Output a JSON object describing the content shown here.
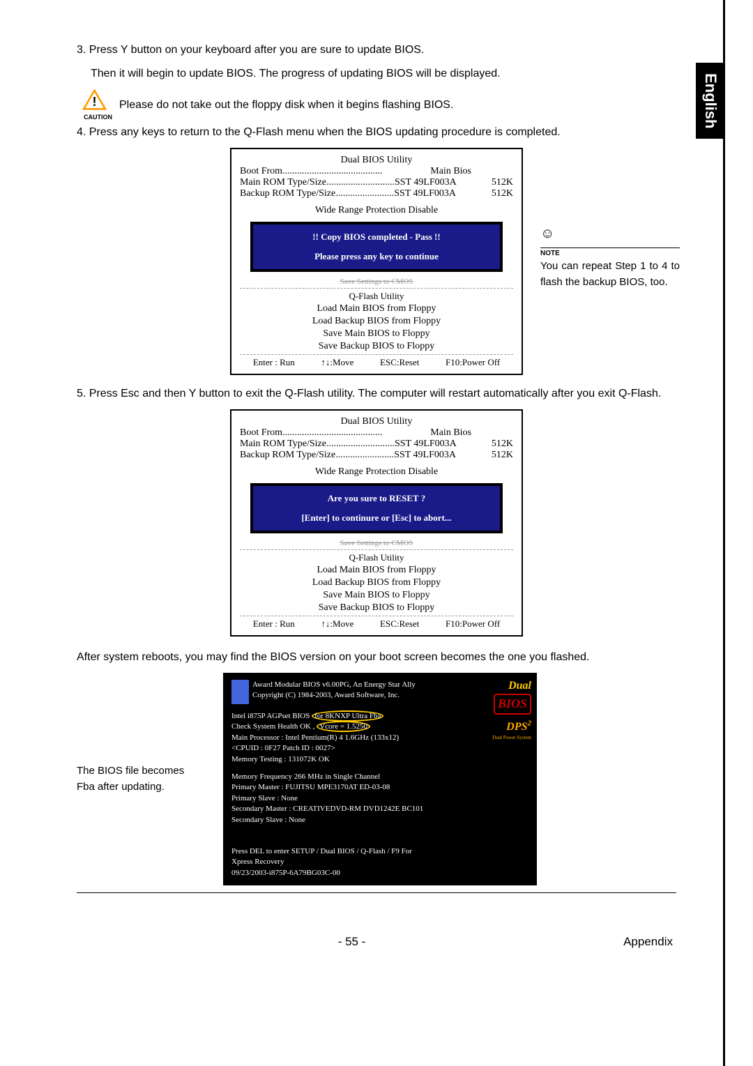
{
  "english_tab": "English",
  "step3_line1": "3. Press Y button on your keyboard after you are sure to update BIOS.",
  "step3_line2": "Then it will begin to update BIOS. The progress of updating BIOS will be displayed.",
  "caution": {
    "label": "CAUTION",
    "text": "Please do not take out the floppy disk when it begins flashing BIOS."
  },
  "step4": "4. Press any keys to return to the Q-Flash menu when the BIOS updating procedure is completed.",
  "bios1": {
    "title": "Dual BIOS Utility",
    "boot_from_label": "Boot From.........................................",
    "boot_from_value": "Main Bios",
    "main_rom_label": "Main ROM Type/Size............................SST 49LF003A",
    "main_rom_size": "512K",
    "backup_rom_label": "Backup ROM Type/Size........................SST 49LF003A",
    "backup_rom_size": "512K",
    "wide_range": "Wide Range Protection    Disable",
    "popup1": "!! Copy BIOS completed - Pass !!",
    "popup2": "Please press any key to continue",
    "qflash": "Q-Flash Utility",
    "menu1": "Load Main BIOS from Floppy",
    "menu2": "Load Backup BIOS from Floppy",
    "menu3": "Save Main BIOS to Floppy",
    "menu4": "Save Backup BIOS to Floppy",
    "key1": "Enter : Run",
    "key2": "↑↓:Move",
    "key3": "ESC:Reset",
    "key4": "F10:Power Off"
  },
  "note": {
    "label": "NOTE",
    "text": "You can repeat Step 1 to 4 to flash the backup BIOS, too."
  },
  "step5": "5.    Press Esc and then Y button to exit the Q-Flash utility. The computer will restart automatically after you exit Q-Flash.",
  "bios2": {
    "popup1": "Are you sure to RESET ?",
    "popup2": "[Enter] to continure or [Esc] to abort..."
  },
  "after_reboot": "After system reboots, you may find the BIOS version on your boot screen becomes the one you flashed.",
  "left_caption": "The BIOS file becomes Fba after updating.",
  "boot": {
    "line1": "Award Modular BIOS v6.00PG, An Energy Star Ally",
    "line2": "Copyright  (C) 1984-2003, Award Software,  Inc.",
    "line3a": "Intel i875P AGPset BIOS ",
    "line3b": "for 8KNXP Ultra Fba",
    "line4a": "Check System Health OK , ",
    "line4b": "Vcore = 1.5250",
    "line5": "Main Processor : Intel Pentium(R) 4  1.6GHz (133x12)",
    "line6": "<CPUID : 0F27 Patch ID  : 0027>",
    "line7": "Memory Testing   : 131072K OK",
    "line8": "Memory Frequency 266 MHz in Single Channel",
    "line9": "Primary Master : FUJITSU MPE3170AT ED-03-08",
    "line10": "Primary Slave : None",
    "line11": "Secondary Master : CREATIVEDVD-RM DVD1242E BC101",
    "line12": "Secondary Slave : None",
    "line13": "Press DEL to enter SETUP / Dual BIOS / Q-Flash / F9 For",
    "line14": "Xpress Recovery",
    "line15": "09/23/2003-i875P-6A79BG03C-00",
    "dual": "Dual",
    "bios_logo": "BIOS",
    "dps": "DPS",
    "dps2": "2",
    "dps_sub": "Dual Power System"
  },
  "page_num": "- 55 -",
  "appendix": "Appendix"
}
